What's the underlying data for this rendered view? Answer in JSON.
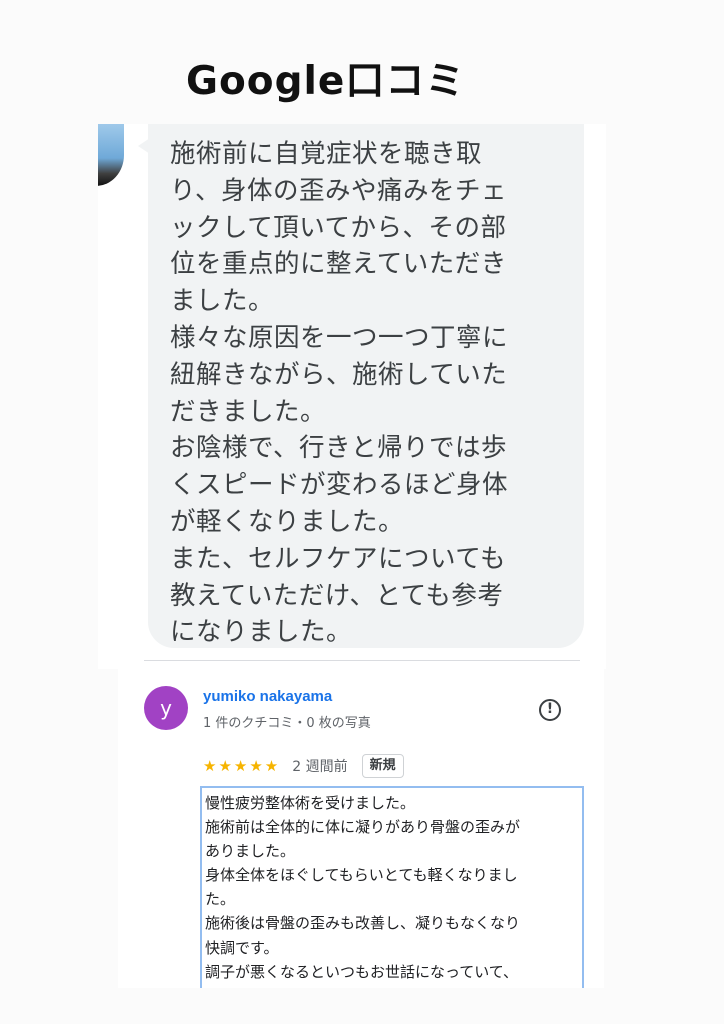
{
  "page": {
    "title": "Google口コミ"
  },
  "review_bubble": {
    "lines": [
      "施術前に自覚症状を聴き取",
      "り、身体の歪みや痛みをチェ",
      "ックして頂いてから、その部",
      "位を重点的に整えていただき",
      "ました。",
      "様々な原因を一つ一つ丁寧に",
      "紐解きながら、施術していた",
      "だきました。",
      "お陰様で、行きと帰りでは歩",
      "くスピードが変わるほど身体",
      "が軽くなりました。",
      "また、セルフケアについても",
      "教えていただけ、とても参考",
      "になりました。"
    ]
  },
  "google_review": {
    "avatar_initial": "y",
    "avatar_color": "#a142c4",
    "reviewer_name": "yumiko nakayama",
    "reviewer_meta": "1 件のクチコミ・0 枚の写真",
    "report_icon": "!",
    "rating": 5,
    "stars": "★★★★★",
    "time": "2 週間前",
    "badge": "新規",
    "text_lines": [
      "慢性疲労整体術を受けました。",
      "施術前は全体的に体に凝りがあり骨盤の歪みが",
      "ありました。",
      "身体全体をほぐしてもらいとても軽くなりまし",
      "た。",
      "施術後は骨盤の歪みも改善し、凝りもなくなり",
      "快調です。",
      "調子が悪くなるといつもお世話になっていて、"
    ]
  },
  "colors": {
    "bubble_bg": "#f1f3f4",
    "name_link": "#1a73e8",
    "star": "#f6b400",
    "selection_border": "#93bdf0"
  }
}
